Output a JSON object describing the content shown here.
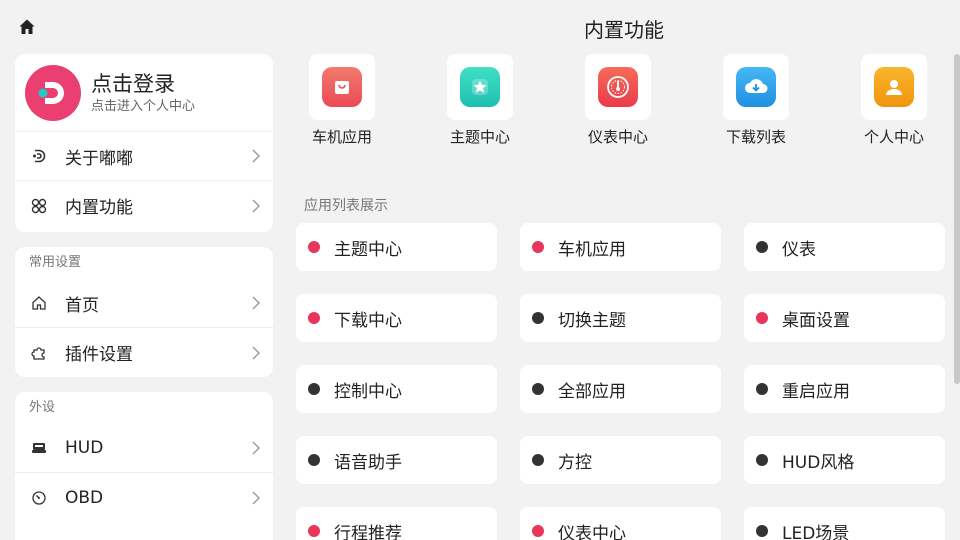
{
  "page_title": "内置功能",
  "login": {
    "title": "点击登录",
    "subtitle": "点击进入个人中心"
  },
  "menu": [
    {
      "label": "关于嘟嘟",
      "icon": "dudu-logo-icon"
    },
    {
      "label": "内置功能",
      "icon": "clover-icon"
    }
  ],
  "common_settings": {
    "title": "常用设置",
    "items": [
      {
        "label": "首页",
        "icon": "home-icon"
      },
      {
        "label": "插件设置",
        "icon": "puzzle-icon"
      }
    ]
  },
  "peripherals": {
    "title": "外设",
    "items": [
      {
        "label": "HUD",
        "icon": "hud-icon"
      },
      {
        "label": "OBD",
        "icon": "gauge-icon"
      }
    ]
  },
  "features": [
    {
      "label": "车机应用",
      "icon": "bag-icon",
      "color": "#ef5b5b"
    },
    {
      "label": "主题中心",
      "icon": "star-icon",
      "color": "#2fcfb8"
    },
    {
      "label": "仪表中心",
      "icon": "speedometer-icon",
      "color": "#f04848"
    },
    {
      "label": "下载列表",
      "icon": "cloud-download-icon",
      "color": "#2a9be8"
    },
    {
      "label": "个人中心",
      "icon": "person-icon",
      "color": "#f5a31a"
    }
  ],
  "app_list": {
    "title": "应用列表展示",
    "items": [
      {
        "label": "主题中心",
        "status": "red"
      },
      {
        "label": "车机应用",
        "status": "red"
      },
      {
        "label": "仪表",
        "status": "dark"
      },
      {
        "label": "下载中心",
        "status": "red"
      },
      {
        "label": "切换主题",
        "status": "dark"
      },
      {
        "label": "桌面设置",
        "status": "red"
      },
      {
        "label": "控制中心",
        "status": "dark"
      },
      {
        "label": "全部应用",
        "status": "dark"
      },
      {
        "label": "重启应用",
        "status": "dark"
      },
      {
        "label": "语音助手",
        "status": "dark"
      },
      {
        "label": "方控",
        "status": "dark"
      },
      {
        "label": "HUD风格",
        "status": "dark"
      },
      {
        "label": "行程推荐",
        "status": "red"
      },
      {
        "label": "仪表中心",
        "status": "red"
      },
      {
        "label": "LED场景",
        "status": "dark"
      }
    ]
  },
  "colors": {
    "red": "#e8365a",
    "dark": "#333333",
    "accent": "#ea3f70"
  }
}
